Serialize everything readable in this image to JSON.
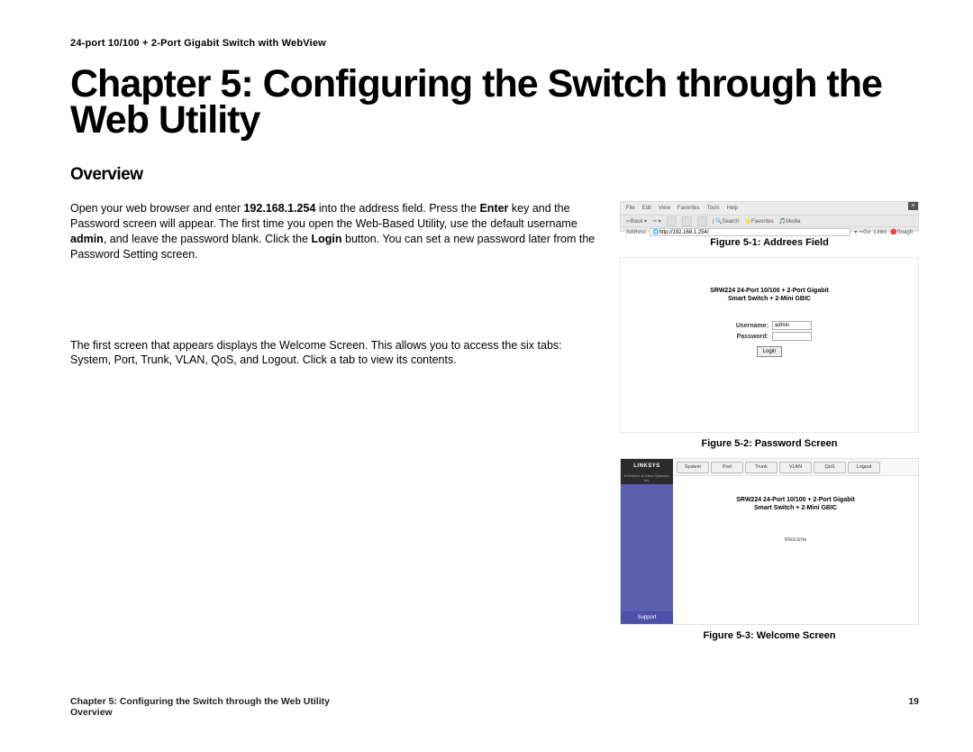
{
  "header": "24-port 10/100 + 2-Port Gigabit Switch with WebView",
  "chapter_title": "Chapter 5: Configuring the Switch through the Web Utility",
  "section_title": "Overview",
  "para1": {
    "t1": "Open your web browser and enter ",
    "ip": "192.168.1.254",
    "t2": " into the address field. Press the ",
    "k_enter": "Enter",
    "t3": " key and the Password screen will appear. The first time you open the Web-Based Utility, use the default username ",
    "k_admin": "admin",
    "t4": ", and leave the password blank. Click the ",
    "k_login": "Login",
    "t5": " button. You can set a new password later from the Password Setting screen."
  },
  "para2": "The first screen that appears displays the Welcome Screen. This allows you to access the six tabs: System, Port, Trunk, VLAN, QoS, and Logout. Click a tab to view its contents.",
  "fig1": {
    "caption": "Figure 5-1: Addrees Field",
    "menu": [
      "File",
      "Edit",
      "View",
      "Favorites",
      "Tools",
      "Help"
    ],
    "toolbar": [
      "Back",
      "",
      "",
      "",
      "Search",
      "Favorites",
      "Media",
      ""
    ],
    "addr_label": "Address",
    "addr_value": "http://192.168.1.254/",
    "go": "Go",
    "links": "Links",
    "snagit": "SnagIt"
  },
  "fig2": {
    "caption": "Figure 5-2: Password Screen",
    "title_l1": "SRW224 24-Port 10/100 + 2-Port Gigabit",
    "title_l2": "Smart Switch + 2-Mini GBIC",
    "username_label": "Username:",
    "username_value": "admin",
    "password_label": "Password:",
    "login_btn": "Login"
  },
  "fig3": {
    "caption": "Figure 5-3: Welcome Screen",
    "brand": "LINKSYS",
    "subbrand": "A Division of Cisco Systems, Inc.",
    "support": "Support",
    "tabs": [
      "System",
      "Port",
      "Trunk",
      "VLAN",
      "QoS",
      "Logout"
    ],
    "title_l1": "SRW224 24-Port 10/100 + 2-Port Gigabit",
    "title_l2": "Smart Switch + 2-Mini GBIC",
    "welcome": "Welcome"
  },
  "footer": {
    "line1": "Chapter 5: Configuring the Switch through the Web Utility",
    "line2": "Overview",
    "page": "19"
  }
}
